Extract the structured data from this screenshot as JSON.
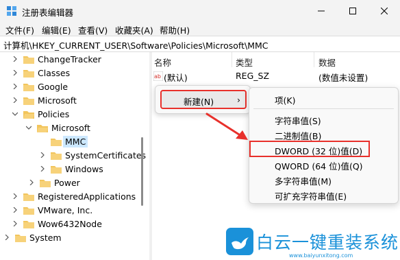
{
  "window": {
    "title": "注册表编辑器"
  },
  "menu": [
    "文件(F)",
    "编辑(E)",
    "查看(V)",
    "收藏夹(A)",
    "帮助(H)"
  ],
  "address": "计算机\\HKEY_CURRENT_USER\\Software\\Policies\\Microsoft\\MMC",
  "tree": [
    {
      "label": "ChangeTracker",
      "expanded": false
    },
    {
      "label": "Classes",
      "expanded": false
    },
    {
      "label": "Google",
      "expanded": false
    },
    {
      "label": "Microsoft",
      "expanded": false
    },
    {
      "label": "Policies",
      "expanded": true
    },
    {
      "label": "Microsoft",
      "expanded": true
    },
    {
      "label": "MMC",
      "selected": true
    },
    {
      "label": "SystemCertificates",
      "expanded": false
    },
    {
      "label": "Windows",
      "expanded": false
    },
    {
      "label": "Power",
      "expanded": false
    },
    {
      "label": "RegisteredApplications",
      "expanded": false
    },
    {
      "label": "VMware, Inc.",
      "expanded": false
    },
    {
      "label": "Wow6432Node",
      "expanded": false
    },
    {
      "label": "System",
      "expanded": false
    }
  ],
  "list": {
    "headers": {
      "name": "名称",
      "type": "类型",
      "data": "数据"
    },
    "rows": [
      {
        "name": "(默认)",
        "type": "REG_SZ",
        "data": "(数值未设置)"
      }
    ]
  },
  "context_menu": {
    "new_label": "新建(N)",
    "arrow": "›"
  },
  "submenu": {
    "key": "项(K)",
    "items": [
      "字符串值(S)",
      "二进制值(B)",
      "DWORD (32 位)值(D)",
      "QWORD (64 位)值(Q)",
      "多字符串值(M)",
      "可扩充字符串值(E)"
    ]
  },
  "watermark": {
    "title": "白云一键重装系统",
    "url": "www.baiyunxitong.com"
  },
  "colors": {
    "highlight": "#e8302b",
    "folder": "#f2c55c",
    "selected": "#cce8ff",
    "brand": "#1a91d9"
  }
}
